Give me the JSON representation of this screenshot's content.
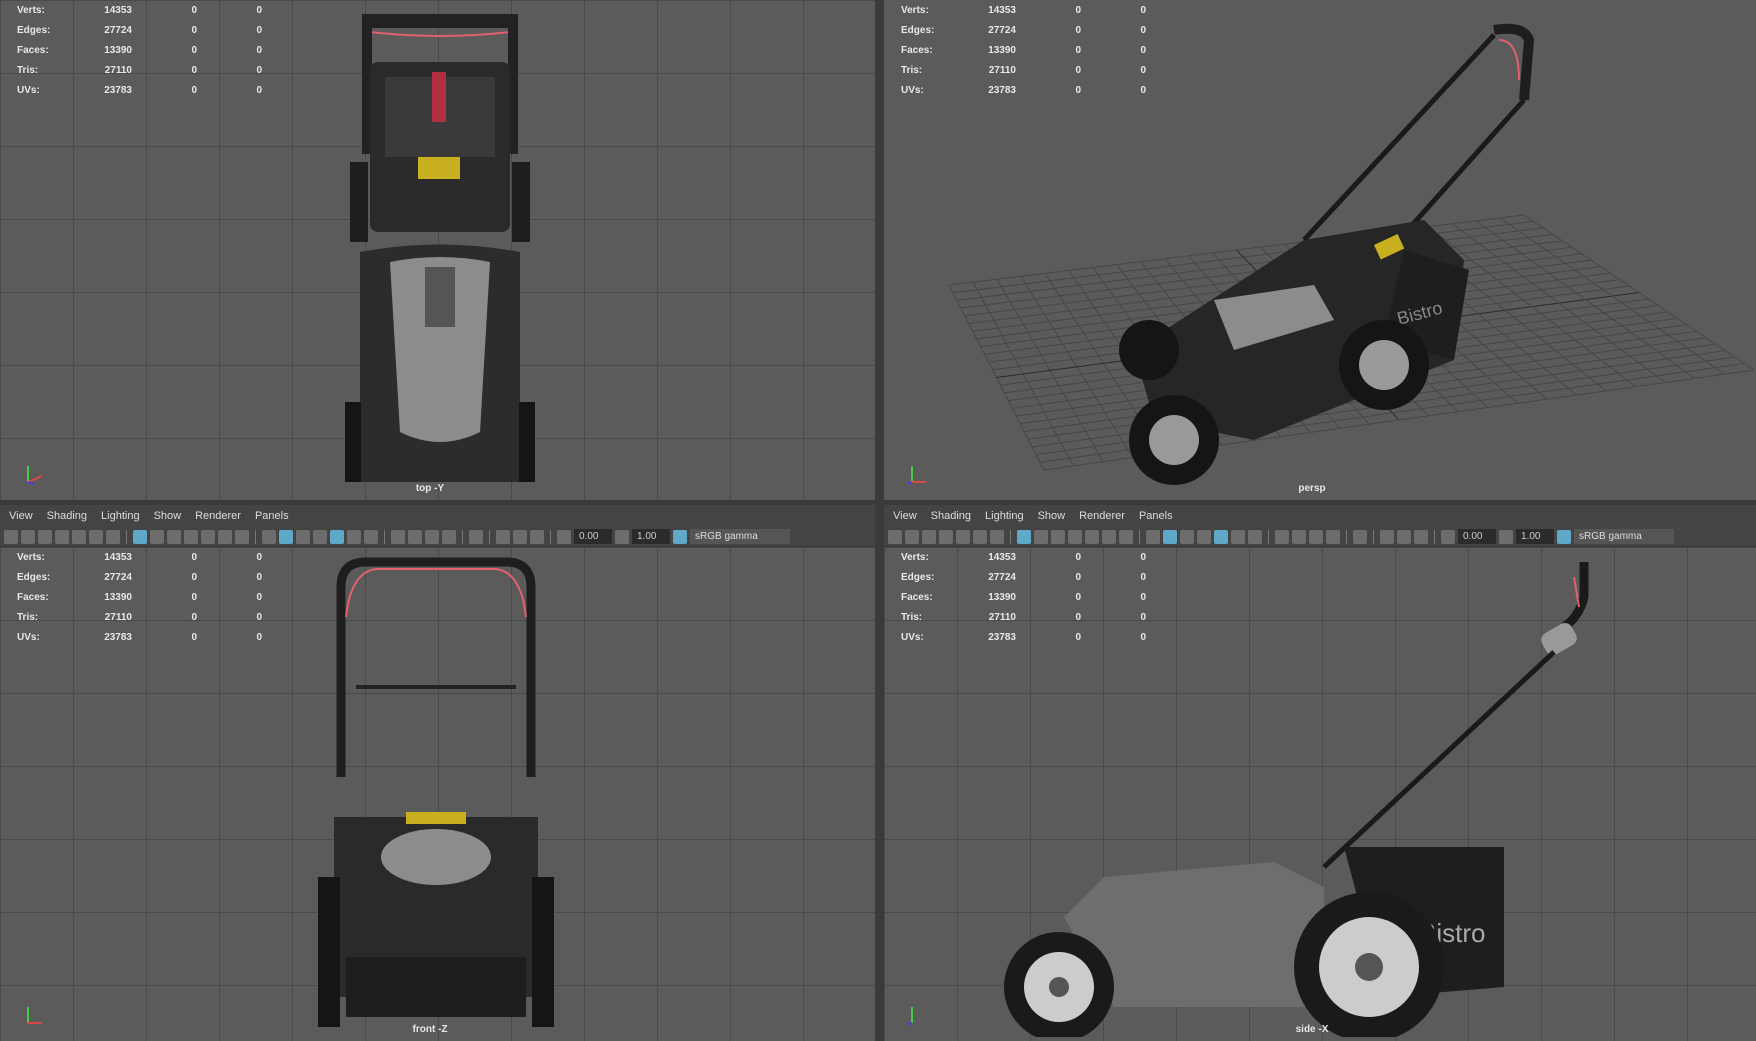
{
  "stats": {
    "labels": [
      "Verts:",
      "Edges:",
      "Faces:",
      "Tris:",
      "UVs:"
    ],
    "values": [
      "14353",
      "27724",
      "13390",
      "27110",
      "23783"
    ],
    "col2": [
      "0",
      "0",
      "0",
      "0",
      "0"
    ],
    "col3": [
      "0",
      "0",
      "0",
      "0",
      "0"
    ]
  },
  "viewports": {
    "top": "top -Y",
    "persp": "persp",
    "front": "front -Z",
    "side": "side -X"
  },
  "menu": [
    "View",
    "Shading",
    "Lighting",
    "Show",
    "Renderer",
    "Panels"
  ],
  "toolbar": {
    "exposure": "0.00",
    "gamma": "1.00",
    "colorspace": "sRGB gamma"
  },
  "brand": "Bistro",
  "toolbar_icons": [
    "camera-icon",
    "camera-lock-icon",
    "camera-attr-icon",
    "bookmark-icon",
    "image-plane-icon",
    "grease-pencil-icon",
    "pen-icon",
    "|",
    "grid-icon",
    "film-gate-icon",
    "resolution-gate-icon",
    "gate-mask-icon",
    "field-chart-icon",
    "safe-action-icon",
    "safe-title-icon",
    "|",
    "wireframe-icon",
    "smooth-shade-icon",
    "default-material-icon",
    "xray-icon",
    "textured-icon",
    "lights-icon",
    "shadows-icon",
    "|",
    "ambient-occlusion-icon",
    "motion-blur-icon",
    "antialias-icon",
    "depth-of-field-icon",
    "|",
    "select-icon",
    "|",
    "isolate-icon",
    "xray-joints-icon",
    "xray-active-icon",
    "|"
  ],
  "colors": {
    "viewport": "#5b5b5b",
    "accent": "#5ea8c8",
    "handle_red": "#e06070"
  }
}
